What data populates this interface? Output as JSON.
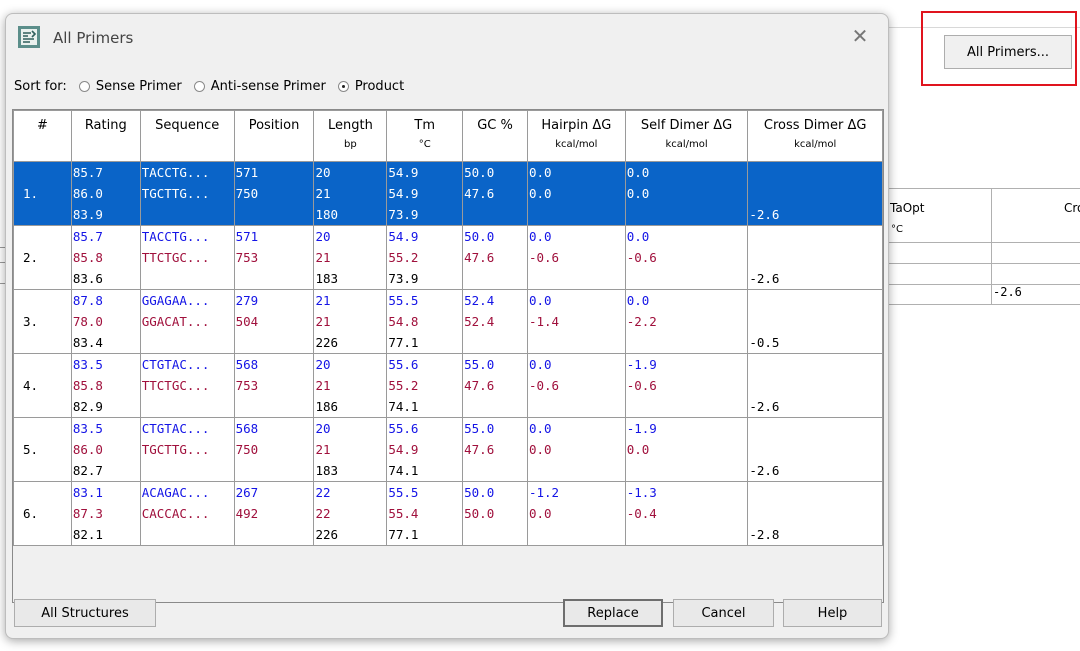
{
  "background": {
    "all_primers_button": "All Primers...",
    "table_headers": {
      "taopt": "TaOpt",
      "taopt_unit": "°C",
      "cross": "Cro"
    },
    "cell_value": "-2.6"
  },
  "dialog": {
    "title": "All Primers",
    "close_glyph": "✕",
    "sort": {
      "label": "Sort for:",
      "options": [
        {
          "label": "Sense Primer",
          "checked": false
        },
        {
          "label": "Anti-sense Primer",
          "checked": false
        },
        {
          "label": "Product",
          "checked": true
        }
      ]
    },
    "columns": [
      {
        "title": "#",
        "unit": ""
      },
      {
        "title": "Rating",
        "unit": ""
      },
      {
        "title": "Sequence",
        "unit": ""
      },
      {
        "title": "Position",
        "unit": ""
      },
      {
        "title": "Length",
        "unit": "bp"
      },
      {
        "title": "Tm",
        "unit": "°C"
      },
      {
        "title": "GC %",
        "unit": ""
      },
      {
        "title": "Hairpin ΔG",
        "unit": "kcal/mol"
      },
      {
        "title": "Self Dimer ΔG",
        "unit": "kcal/mol"
      },
      {
        "title": "Cross Dimer ΔG",
        "unit": "kcal/mol"
      }
    ],
    "rows": [
      {
        "num": "1.",
        "selected": true,
        "rating": [
          "85.7",
          "86.0",
          "83.9"
        ],
        "sequence": [
          "TACCTG...",
          "TGCTTG...",
          ""
        ],
        "position": [
          "571",
          "750",
          ""
        ],
        "length": [
          "20",
          "21",
          "180"
        ],
        "tm": [
          "54.9",
          "54.9",
          "73.9"
        ],
        "gc": [
          "50.0",
          "47.6",
          ""
        ],
        "hairpin": [
          "0.0",
          "0.0",
          ""
        ],
        "self": [
          "0.0",
          "0.0",
          ""
        ],
        "cross": [
          "",
          "",
          "-2.6"
        ]
      },
      {
        "num": "2.",
        "selected": false,
        "rating": [
          "85.7",
          "85.8",
          "83.6"
        ],
        "sequence": [
          "TACCTG...",
          "TTCTGC...",
          ""
        ],
        "position": [
          "571",
          "753",
          ""
        ],
        "length": [
          "20",
          "21",
          "183"
        ],
        "tm": [
          "54.9",
          "55.2",
          "73.9"
        ],
        "gc": [
          "50.0",
          "47.6",
          ""
        ],
        "hairpin": [
          "0.0",
          "-0.6",
          ""
        ],
        "self": [
          "0.0",
          "-0.6",
          ""
        ],
        "cross": [
          "",
          "",
          "-2.6"
        ]
      },
      {
        "num": "3.",
        "selected": false,
        "rating": [
          "87.8",
          "78.0",
          "83.4"
        ],
        "sequence": [
          "GGAGAA...",
          "GGACAT...",
          ""
        ],
        "position": [
          "279",
          "504",
          ""
        ],
        "length": [
          "21",
          "21",
          "226"
        ],
        "tm": [
          "55.5",
          "54.8",
          "77.1"
        ],
        "gc": [
          "52.4",
          "52.4",
          ""
        ],
        "hairpin": [
          "0.0",
          "-1.4",
          ""
        ],
        "self": [
          "0.0",
          "-2.2",
          ""
        ],
        "cross": [
          "",
          "",
          "-0.5"
        ]
      },
      {
        "num": "4.",
        "selected": false,
        "rating": [
          "83.5",
          "85.8",
          "82.9"
        ],
        "sequence": [
          "CTGTAC...",
          "TTCTGC...",
          ""
        ],
        "position": [
          "568",
          "753",
          ""
        ],
        "length": [
          "20",
          "21",
          "186"
        ],
        "tm": [
          "55.6",
          "55.2",
          "74.1"
        ],
        "gc": [
          "55.0",
          "47.6",
          ""
        ],
        "hairpin": [
          "0.0",
          "-0.6",
          ""
        ],
        "self": [
          "-1.9",
          "-0.6",
          ""
        ],
        "cross": [
          "",
          "",
          "-2.6"
        ]
      },
      {
        "num": "5.",
        "selected": false,
        "rating": [
          "83.5",
          "86.0",
          "82.7"
        ],
        "sequence": [
          "CTGTAC...",
          "TGCTTG...",
          ""
        ],
        "position": [
          "568",
          "750",
          ""
        ],
        "length": [
          "20",
          "21",
          "183"
        ],
        "tm": [
          "55.6",
          "54.9",
          "74.1"
        ],
        "gc": [
          "55.0",
          "47.6",
          ""
        ],
        "hairpin": [
          "0.0",
          "0.0",
          ""
        ],
        "self": [
          "-1.9",
          "0.0",
          ""
        ],
        "cross": [
          "",
          "",
          "-2.6"
        ]
      },
      {
        "num": "6.",
        "selected": false,
        "rating": [
          "83.1",
          "87.3",
          "82.1"
        ],
        "sequence": [
          "ACAGAC...",
          "CACCAC...",
          ""
        ],
        "position": [
          "267",
          "492",
          ""
        ],
        "length": [
          "22",
          "22",
          "226"
        ],
        "tm": [
          "55.5",
          "55.4",
          "77.1"
        ],
        "gc": [
          "50.0",
          "50.0",
          ""
        ],
        "hairpin": [
          "-1.2",
          "0.0",
          ""
        ],
        "self": [
          "-1.3",
          "-0.4",
          ""
        ],
        "cross": [
          "",
          "",
          "-2.8"
        ]
      }
    ],
    "buttons": {
      "all_structures": "All Structures",
      "replace": "Replace",
      "cancel": "Cancel",
      "help": "Help"
    }
  },
  "colors": {
    "sense": "#1414e6",
    "antisense": "#a0103c",
    "selection": "#0a64c8",
    "highlight": "#e0141e"
  }
}
